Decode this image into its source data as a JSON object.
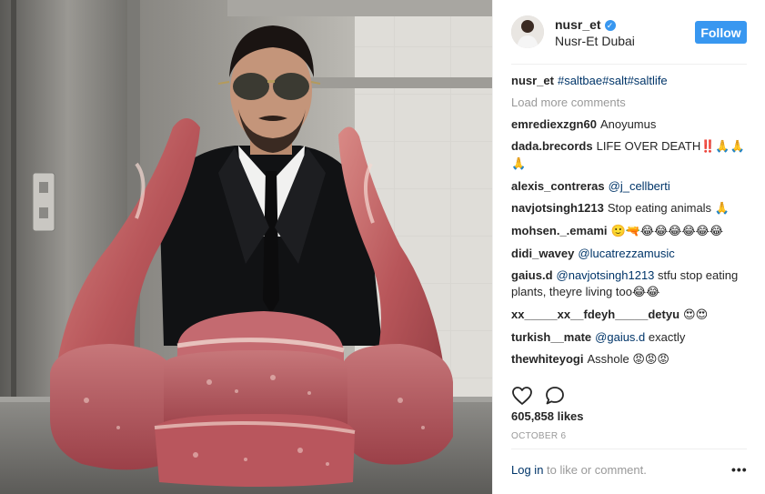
{
  "post": {
    "photo_alt": "",
    "author": {
      "username": "nusr_et",
      "verified": true,
      "location": "Nusr-Et Dubai",
      "follow_label": "Follow"
    },
    "caption": {
      "username": "nusr_et",
      "text": "#saltbae#salt#saltlife"
    },
    "load_more_label": "Load more comments",
    "comments": [
      {
        "username": "emrediexzgn60",
        "text": "Anoyumus"
      },
      {
        "username": "dada.brecords",
        "text": "LIFE OVER DEATH",
        "emoji": "‼️🙏🙏🙏"
      },
      {
        "username": "alexis_contreras",
        "mention": "@j_cellberti"
      },
      {
        "username": "navjotsingh1213",
        "text": "Stop eating animals",
        "emoji": "🙏"
      },
      {
        "username": "mohsen._.emami",
        "emoji": "🙂🔫😂😂😂😂😂😂"
      },
      {
        "username": "didi_wavey",
        "mention": "@lucatrezzamusic"
      },
      {
        "username": "gaius.d",
        "mention": "@navjotsingh1213",
        "text": "stfu stop eating plants, theyre living too",
        "emoji": "😂😂"
      },
      {
        "username": "xx_____xx__fdeyh_____detyu",
        "emoji": "😍😍"
      },
      {
        "username": "turkish__mate",
        "mention": "@gaius.d",
        "text": "exactly"
      },
      {
        "username": "thewhiteyogi",
        "text": "Asshole",
        "emoji": "😡😡😡"
      }
    ],
    "likes": "605,858 likes",
    "date": "OCTOBER 6",
    "login_link": "Log in",
    "login_text": " to like or comment.",
    "more_label": "•••",
    "colors": {
      "accent": "#3897f0",
      "link": "#003569",
      "muted": "#999999",
      "text": "#262626"
    },
    "icons": [
      "heart-icon",
      "comment-icon",
      "verified-badge-icon",
      "more-options-icon"
    ]
  }
}
